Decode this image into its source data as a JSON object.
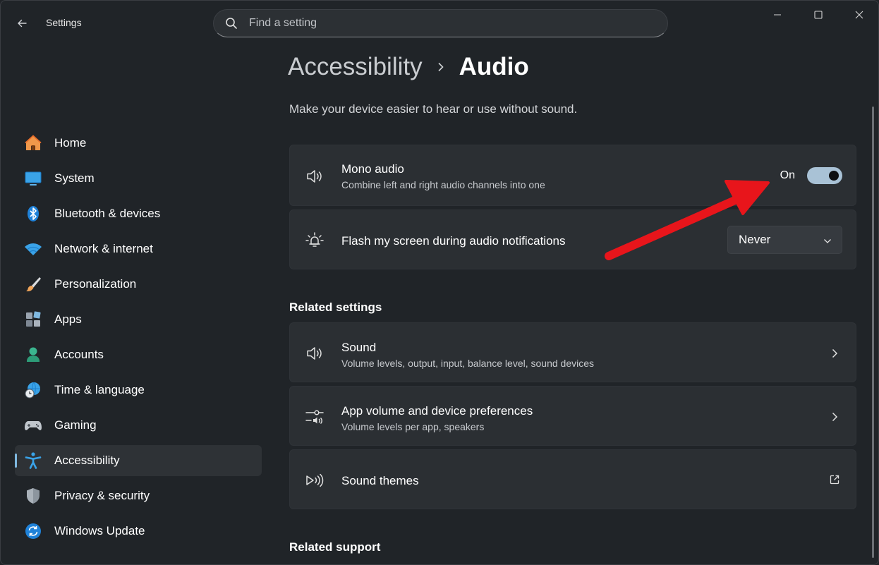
{
  "app": {
    "title": "Settings",
    "search_placeholder": "Find a setting"
  },
  "sidebar": {
    "items": [
      {
        "label": "Home",
        "icon": "home-icon",
        "active": false
      },
      {
        "label": "System",
        "icon": "system-icon",
        "active": false
      },
      {
        "label": "Bluetooth & devices",
        "icon": "bluetooth-icon",
        "active": false
      },
      {
        "label": "Network & internet",
        "icon": "wifi-icon",
        "active": false
      },
      {
        "label": "Personalization",
        "icon": "brush-icon",
        "active": false
      },
      {
        "label": "Apps",
        "icon": "apps-icon",
        "active": false
      },
      {
        "label": "Accounts",
        "icon": "account-icon",
        "active": false
      },
      {
        "label": "Time & language",
        "icon": "globe-clock-icon",
        "active": false
      },
      {
        "label": "Gaming",
        "icon": "gamepad-icon",
        "active": false
      },
      {
        "label": "Accessibility",
        "icon": "accessibility-icon",
        "active": true
      },
      {
        "label": "Privacy & security",
        "icon": "shield-icon",
        "active": false
      },
      {
        "label": "Windows Update",
        "icon": "update-icon",
        "active": false
      }
    ]
  },
  "main": {
    "breadcrumb_parent": "Accessibility",
    "breadcrumb_current": "Audio",
    "subtitle": "Make your device easier to hear or use without sound.",
    "mono_audio": {
      "title": "Mono audio",
      "description": "Combine left and right audio channels into one",
      "state_label": "On",
      "enabled": true
    },
    "flash_screen": {
      "title": "Flash my screen during audio notifications",
      "selected": "Never"
    },
    "related_settings_title": "Related settings",
    "related": [
      {
        "title": "Sound",
        "description": "Volume levels, output, input, balance level, sound devices"
      },
      {
        "title": "App volume and device preferences",
        "description": "Volume levels per app, speakers"
      },
      {
        "title": "Sound themes",
        "description": ""
      }
    ],
    "related_support_title": "Related support"
  },
  "colors": {
    "accent": "#7fb8e0",
    "annotation_arrow": "#e8151b",
    "toggle_on": "#a9c2d6"
  }
}
